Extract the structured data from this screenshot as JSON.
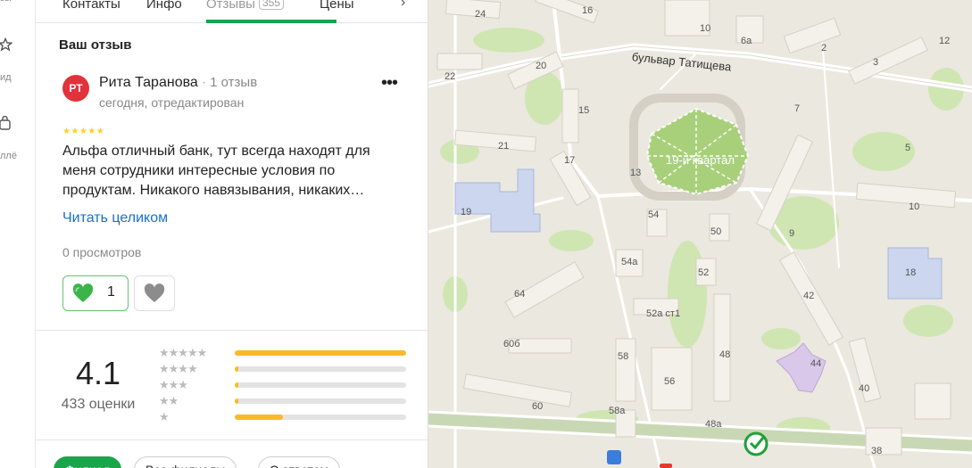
{
  "rail": {
    "items": [
      {
        "label": "зы",
        "icon": "star-icon"
      },
      {
        "label": "ид",
        "icon": "star-outline-icon"
      },
      {
        "label": "ллё",
        "icon": "bag-icon"
      }
    ]
  },
  "tabs": {
    "items": [
      "Контакты",
      "Инфо",
      "Отзывы",
      "Цены"
    ],
    "badge": "355"
  },
  "review": {
    "section_title": "Ваш отзыв",
    "avatar_initials": "РТ",
    "author": "Рита Таранова",
    "author_reviews": "1 отзыв",
    "date": "сегодня, отредактирован",
    "stars": "★★★★★",
    "text": "Альфа отличный банк, тут всегда находят для меня сотрудники интересные условия по продуктам. Никакого навязывания, никаких…",
    "read_more": "Читать целиком",
    "views": "0 просмотров",
    "likes": "1",
    "more_icon": "more-dots-icon"
  },
  "rating": {
    "value": "4.1",
    "count_label": "433 оценки",
    "distribution": [
      {
        "stars": "★★★★★",
        "share": 1.0
      },
      {
        "stars": "★★★★",
        "share": 0.02
      },
      {
        "stars": "★★★",
        "share": 0.02
      },
      {
        "stars": "★★",
        "share": 0.02
      },
      {
        "stars": "★",
        "share": 0.28
      }
    ]
  },
  "filters": {
    "items": [
      "Филиал",
      "Все филиалы",
      "С ответом"
    ]
  },
  "map": {
    "street": "бульвар Татищева",
    "park": "19-й квартал",
    "labels": [
      "24",
      "16",
      "10",
      "6а",
      "2",
      "20",
      "22",
      "12",
      "15",
      "7",
      "3",
      "21",
      "17",
      "13",
      "5",
      "19",
      "54",
      "50",
      "9",
      "10",
      "54а",
      "52",
      "18",
      "64",
      "42",
      "52а ст1",
      "60б",
      "58",
      "48",
      "56",
      "44",
      "40",
      "60",
      "58а",
      "48а",
      "38"
    ]
  },
  "colors": {
    "accent": "#14a44d",
    "avatar": "#e2323b",
    "link": "#1a6fc4",
    "bar": "#fbb927",
    "like": "#3bb54a"
  }
}
